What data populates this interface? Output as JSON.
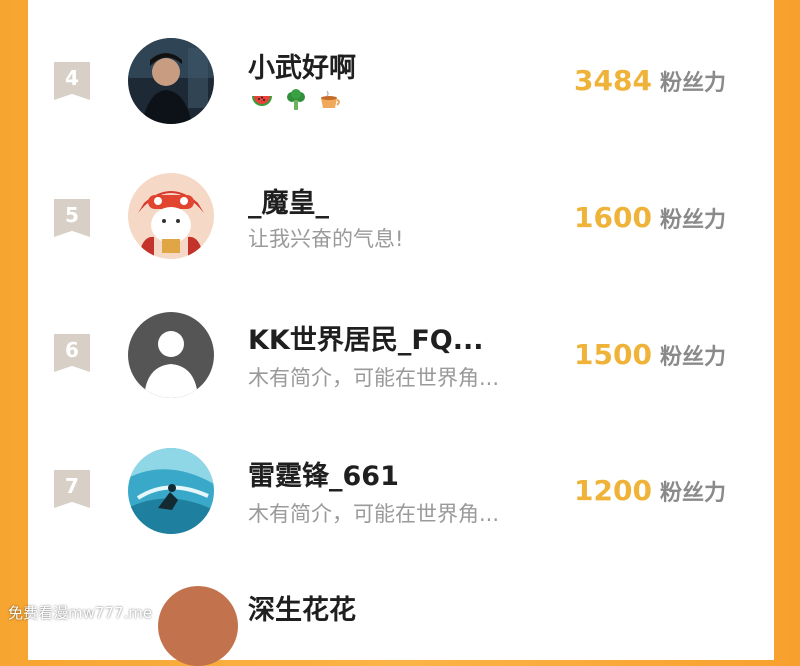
{
  "leaderboard": {
    "rows": [
      {
        "rank": "4",
        "name": "小武好啊",
        "bio": "",
        "fans": "3484",
        "fans_label": "粉丝力",
        "badges": [
          "watermelon-icon",
          "broccoli-icon",
          "tea-icon"
        ]
      },
      {
        "rank": "5",
        "name": "_魔皇_",
        "bio": "让我兴奋的气息!",
        "fans": "1600",
        "fans_label": "粉丝力"
      },
      {
        "rank": "6",
        "name": "KK世界居民_FQ...",
        "bio": "木有简介，可能在世界角...",
        "fans": "1500",
        "fans_label": "粉丝力"
      },
      {
        "rank": "7",
        "name": "雷霆锋_661",
        "bio": "木有简介，可能在世界角...",
        "fans": "1200",
        "fans_label": "粉丝力"
      }
    ],
    "partial_next_name": "深生花花"
  },
  "watermark": "免费看漫mw777.me",
  "colors": {
    "accent_orange": "#f7a531",
    "fans_number": "#f0b33a",
    "rank_badge": "#d8cfc7"
  }
}
